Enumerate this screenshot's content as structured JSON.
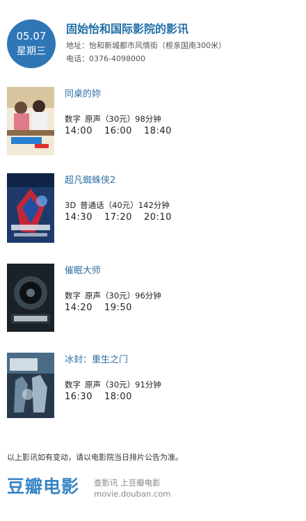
{
  "header": {
    "date": "05.07",
    "weekday": "星期三",
    "cinema_name": "固始怡和国际影院的影讯",
    "address": "地址：怡和新城都市风情街（根亲国南300米）",
    "phone": "电话：0376-4098000"
  },
  "movies": [
    {
      "title": "同桌的妳",
      "format": "数字",
      "language": "原声",
      "price": "（30元）",
      "duration": "98分钟",
      "times": [
        "14:00",
        "16:00",
        "18:40"
      ],
      "poster_icon": "poster-image"
    },
    {
      "title": "超凡蜘蛛侠2",
      "format": "3D",
      "language": "普通话",
      "price": "（40元）",
      "duration": "142分钟",
      "times": [
        "14:30",
        "17:20",
        "20:10"
      ],
      "poster_icon": "poster-image"
    },
    {
      "title": "催眠大师",
      "format": "数字",
      "language": "原声",
      "price": "（30元）",
      "duration": "96分钟",
      "times": [
        "14:20",
        "19:50"
      ],
      "poster_icon": "poster-image"
    },
    {
      "title": "冰封：重生之门",
      "format": "数字",
      "language": "原声",
      "price": "（30元）",
      "duration": "91分钟",
      "times": [
        "16:30",
        "18:00"
      ],
      "poster_icon": "poster-image"
    }
  ],
  "footnote": "以上影讯如有变动，请以电影院当日排片公告为准。",
  "footer": {
    "logo_text": "豆瓣电影",
    "slogan": "查影讯  上豆瓣电影",
    "site": "movie.douban.com"
  },
  "colors": {
    "accent": "#2f76b7",
    "title": "#1f6fa8",
    "logo": "#3a86c5"
  }
}
